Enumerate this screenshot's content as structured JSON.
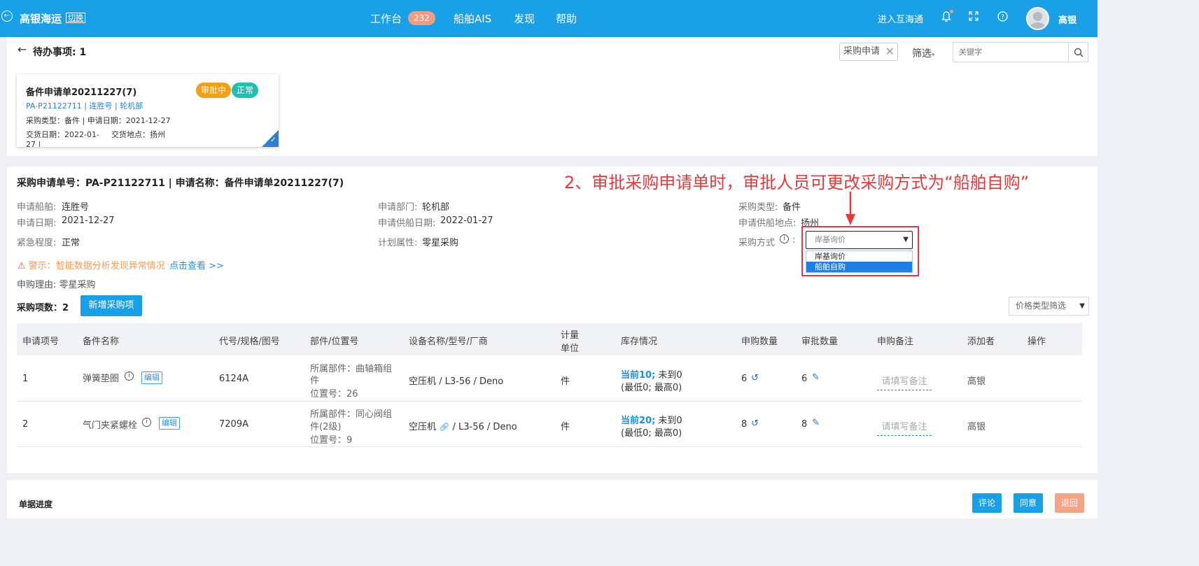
{
  "topbar": {
    "brand": "高银海运",
    "switch_label": "切换",
    "nav": [
      {
        "label": "工作台",
        "badge": "232"
      },
      {
        "label": "船舶AIS"
      },
      {
        "label": "发现"
      },
      {
        "label": "帮助"
      }
    ],
    "enter_label": "进入互海通",
    "user_name": "高银",
    "bg_color": "#1aa0e6"
  },
  "pending": {
    "title": "待办事项: 1",
    "filter_tag": "采购申请",
    "filter_label": "筛选",
    "keyword_placeholder": "关键字"
  },
  "card": {
    "title": "备件申请单20211227(7)",
    "links": "PA-P21122711 | 连胜号 | 轮机部",
    "line1": "采购类型：备件 | 申请日期：2021-12-27",
    "line2a": "交货日期：2022-01-",
    "line2b": "交货地点：扬州",
    "line3": "27 |",
    "status_badge": "审批中",
    "priority_badge": "正常"
  },
  "detail": {
    "header": "采购申请单号：PA-P21122711 | 申请名称：备件申请单20211227(7)",
    "annotation": "2、审批采购申请单时，审批人员可更改采购方式为“船舶自购”",
    "fields": {
      "ship_label": "申请船舶:",
      "ship_value": "连胜号",
      "date_label": "申请日期:",
      "date_value": "2021-12-27",
      "urgency_label": "紧急程度:",
      "urgency_value": "正常",
      "dept_label": "申请部门:",
      "dept_value": "轮机部",
      "supply_date_label": "申请供船日期:",
      "supply_date_value": "2022-01-27",
      "plan_label": "计划属性:",
      "plan_value": "零星采购",
      "type_label": "采购类型:",
      "type_value": "备件",
      "place_label": "申请供船地点:",
      "place_value": "扬州",
      "method_label": "采购方式",
      "method_colon": ":"
    },
    "method_select": {
      "selected": "岸基询价",
      "options": [
        "岸基询价",
        "船舶自购"
      ]
    },
    "warning": "警示：智能数据分析发现异常情况",
    "warning_link": "点击查看 >>",
    "reason": "申购理由: 零星采购",
    "item_count": "采购项数：2",
    "add_button": "新增采购项",
    "price_filter": "价格类型筛选"
  },
  "table": {
    "headers": {
      "no": "申请项号",
      "name": "备件名称",
      "code": "代号/规格/图号",
      "part": "部件/位置号",
      "equip": "设备名称/型号/厂商",
      "unit1": "计量",
      "unit2": "单位",
      "stock": "库存情况",
      "req_qty": "申购数量",
      "appr_qty": "审批数量",
      "remark": "申购备注",
      "adder": "添加者",
      "ops": "操作"
    },
    "rows": [
      {
        "no": "1",
        "name": "弹簧垫圈",
        "edit": "编辑",
        "code": "6124A",
        "part1": "所属部件：曲轴箱组",
        "part2": "件",
        "pos": "位置号：26",
        "equip": "空压机 / L3-56 / Deno",
        "unit": "件",
        "stock_a": "当前10;",
        "stock_b": " 未到0",
        "stock_c": "(最低0; 最高0)",
        "req_qty": "6",
        "appr_qty": "6",
        "remark_placeholder": "请填写备注",
        "adder": "高银"
      },
      {
        "no": "2",
        "name": "气门夹紧螺栓",
        "edit": "编辑",
        "code": "7209A",
        "part1": "所属部件：同心阀组",
        "part2": "件(2级)",
        "pos": "位置号：9",
        "equip_a": "空压机",
        "equip_b": "/ L3-56 / Deno",
        "unit": "件",
        "stock_a": "当前20;",
        "stock_b": " 未到0",
        "stock_c": "(最低0; 最高0)",
        "req_qty": "8",
        "appr_qty": "8",
        "remark_placeholder": "请填写备注",
        "adder": "高银"
      }
    ]
  },
  "progress": {
    "title": "单据进度",
    "comment_button": "评论",
    "agree_button": "同意",
    "return_button": "退回"
  }
}
